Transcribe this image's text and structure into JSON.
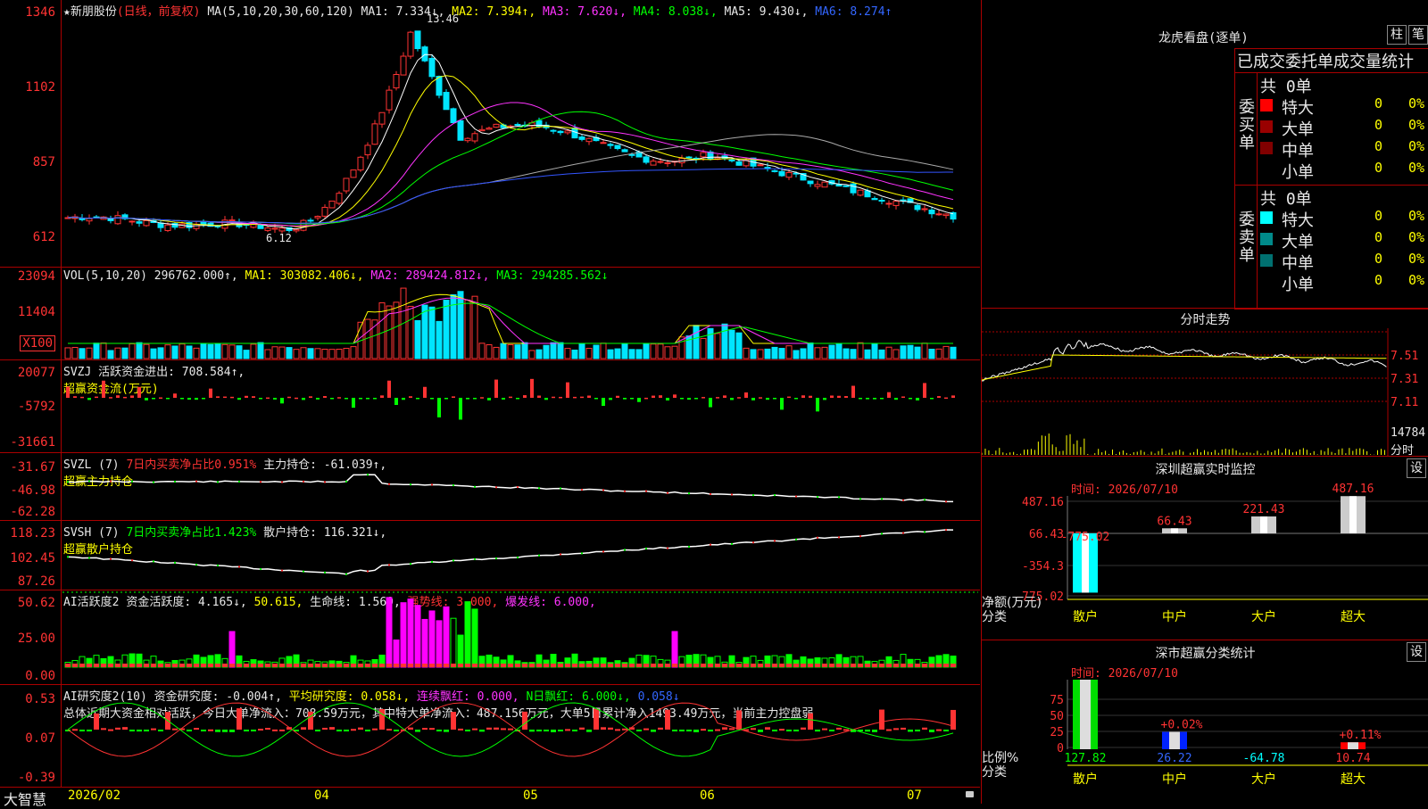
{
  "main_chart": {
    "title": "★新朋股份",
    "mode": "(日线，前复权)",
    "ma_label": "MA(5,10,20,30,60,120)",
    "ma1": "MA1: 7.334↓,",
    "ma2": "MA2: 7.394↑,",
    "ma3": "MA3: 7.620↓,",
    "ma4": "MA4: 8.038↓,",
    "ma5": "MA5: 9.430↓,",
    "ma6": "MA6: 8.274↑",
    "y_ticks": [
      "1346",
      "1102",
      "857",
      "612"
    ],
    "high_label": "13.46",
    "low_label": "6.12"
  },
  "vol_pane": {
    "label": "VOL(5,10,20)",
    "value": "296762.000↑,",
    "ma1": "MA1: 303082.406↓,",
    "ma2": "MA2: 289424.812↓,",
    "ma3": "MA3: 294285.562↓",
    "y_ticks": [
      "23094",
      "11404"
    ],
    "unit": "X100"
  },
  "svzj_pane": {
    "label": "SVZJ",
    "name": "活跃资金进出: 708.584↑,",
    "sub": "超赢资金流(万元)",
    "y_ticks": [
      "20077",
      "-5792",
      "-31661"
    ]
  },
  "svzl_pane": {
    "label": "SVZL (7)",
    "pct": "7日内买卖净占比0.951%",
    "hold": "主力持仓: -61.039↑,",
    "sub": "超赢主力持仓",
    "y_ticks": [
      "-31.67",
      "-46.98",
      "-62.28"
    ]
  },
  "svsh_pane": {
    "label": "SVSH (7)",
    "pct": "7日内买卖净占比1.423%",
    "hold": "散户持仓: 116.321↓,",
    "sub": "超赢散户持仓",
    "y_ticks": [
      "118.23",
      "102.45",
      "87.26"
    ]
  },
  "ai_active_pane": {
    "label": "AI活跃度2",
    "v1": "资金活跃度: 4.165↓,",
    "v2": "50.615,",
    "v3": "生命线: 1.560,",
    "v4": "强势线: 3.000,",
    "v5": "爆发线: 6.000,",
    "y_ticks": [
      "50.62",
      "25.00",
      "0.00"
    ]
  },
  "ai_research_pane": {
    "label": "AI研究度2(10)",
    "v1": "资金研究度: -0.004↑,",
    "v2": "平均研究度: 0.058↓,",
    "v3": "连续飘红: 0.000,",
    "v4": "N日飘红: 6.000↓,",
    "v5": "0.058↓",
    "summary": "总体近期大资金相对活跃，今日大单净流入：708.59万元，其中特大单净流入：487.156万元，大单5日累计净入1493.49万元，当前主力控盘弱",
    "y_ticks": [
      "0.53",
      "0.07",
      "-0.39"
    ]
  },
  "x_axis": {
    "brand": "大智慧",
    "labels": [
      "2026/02",
      "04",
      "05",
      "06",
      "07"
    ]
  },
  "dragon_tiger": {
    "title": "龙虎看盘(逐单)",
    "btn1": "柱",
    "btn2": "笔",
    "header": "已成交委托单成交量统计",
    "buy_side": "委买单",
    "sell_side": "委卖单",
    "buy_total": "共 0单",
    "sell_total": "共 0单",
    "buy_rows": [
      {
        "name": "特大",
        "count": "0",
        "pct": "0%",
        "color": "#ff0000"
      },
      {
        "name": "大单",
        "count": "0",
        "pct": "0%",
        "color": "#990000"
      },
      {
        "name": "中单",
        "count": "0",
        "pct": "0%",
        "color": "#800000"
      },
      {
        "name": "小单",
        "count": "0",
        "pct": "0%",
        "color": ""
      }
    ],
    "sell_rows": [
      {
        "name": "特大",
        "count": "0",
        "pct": "0%",
        "color": "#00ffff"
      },
      {
        "name": "大单",
        "count": "0",
        "pct": "0%",
        "color": "#008a8a"
      },
      {
        "name": "中单",
        "count": "0",
        "pct": "0%",
        "color": "#007070"
      },
      {
        "name": "小单",
        "count": "0",
        "pct": "0%",
        "color": ""
      }
    ]
  },
  "intraday": {
    "title": "分时走势",
    "y_ticks": [
      "7.51",
      "7.31",
      "7.11"
    ],
    "vol_top": "14784",
    "vol_label": "分时"
  },
  "sz_monitor": {
    "title": "深圳超赢实时监控",
    "btn": "设",
    "time": "时间: 2026/07/10",
    "y_ticks": [
      "487.16",
      "66.43",
      "-354.3",
      "-775.02"
    ],
    "unit_label": "净额(万元)",
    "cat_label": "分类",
    "categories": [
      "散户",
      "中户",
      "大户",
      "超大"
    ],
    "values": [
      -775.02,
      66.43,
      221.43,
      487.16
    ],
    "value_labels": [
      "-775.02",
      "66.43",
      "221.43",
      "487.16"
    ]
  },
  "sz_classify": {
    "title": "深市超赢分类统计",
    "btn": "设",
    "time": "时间: 2026/07/10",
    "y_ticks": [
      "75",
      "50",
      "25",
      "0"
    ],
    "ratio_label": "比例%",
    "cat_label": "分类",
    "categories": [
      "散户",
      "中户",
      "大户",
      "超大"
    ],
    "bottom_values": [
      "127.82",
      "26.22",
      "-64.78",
      "10.74"
    ],
    "bar_labels": [
      "",
      "+0.02%",
      "",
      "+0.11%"
    ],
    "bar_values": [
      100,
      25,
      0,
      10
    ]
  },
  "colors": {
    "up": "#ff3333",
    "down": "#00e5ff",
    "frame": "#aa0000"
  }
}
